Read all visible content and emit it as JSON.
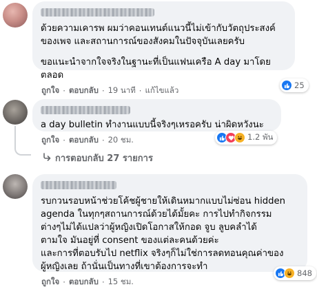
{
  "comments": [
    {
      "paragraphs": [
        "ด้วยความเคารพ ผมว่าคอนเทนต์แนวนี้ไม่เข้ากับวัตถุประสงค์\nของเพจ และสถานการณ์ของสังคมในปัจจุบันเลยครับ",
        "ขอแนะนำจากใจจริงในฐานะที่เป็นแฟนเครือ A day มาโดย\nตลอด"
      ],
      "like_label": "ถูกใจ",
      "reply_label": "ตอบกลับ",
      "time": "19 นาที",
      "edited": "แก้ไขแล้ว",
      "reaction_count": "25"
    },
    {
      "paragraphs": [
        "a day bulletin ทำงานแบบนี้จริงๆเหรอครับ น่าผิดหวังนะ"
      ],
      "like_label": "ถูกใจ",
      "reply_label": "ตอบกลับ",
      "time": "20 ชม.",
      "reaction_count": "1.2 พัน",
      "replies_label": "การตอบกลับ 27 รายการ"
    },
    {
      "paragraphs": [
        "รบกวนรอบหน้าช่วยโค้ชผู้ชายให้เดินหมากแบบไม่ซ่อน hidden\nagenda ในทุกๆสถานการณ์ด้วยได้มั้ยคะ การไปทำกิจกรรม\nต่างๆไม่ได้แปลว่าผู้หญิงเปิดโอกาสให้กอด จูบ ลูบคลำได้\nตามใจ มันอยู่ที่ consent ของแต่ละคนด้วยค่ะ\nและการที่ตอบรับไป netflix จริงๆก็ไม่ใช่การลดทอนคุณค่าของ\nผู้หญิงเลย ถ้านั่นเป็นทางที่เขาต้องการจะทำ"
      ],
      "like_label": "ถูกใจ",
      "reply_label": "ตอบกลับ",
      "time": "15 ชม.",
      "reaction_count": "848"
    }
  ],
  "colors": {
    "bubble": "#f0f2f5",
    "meta": "#65676b",
    "like": "#1877f2",
    "love": "#f33e58",
    "haha": "#f7b125"
  }
}
